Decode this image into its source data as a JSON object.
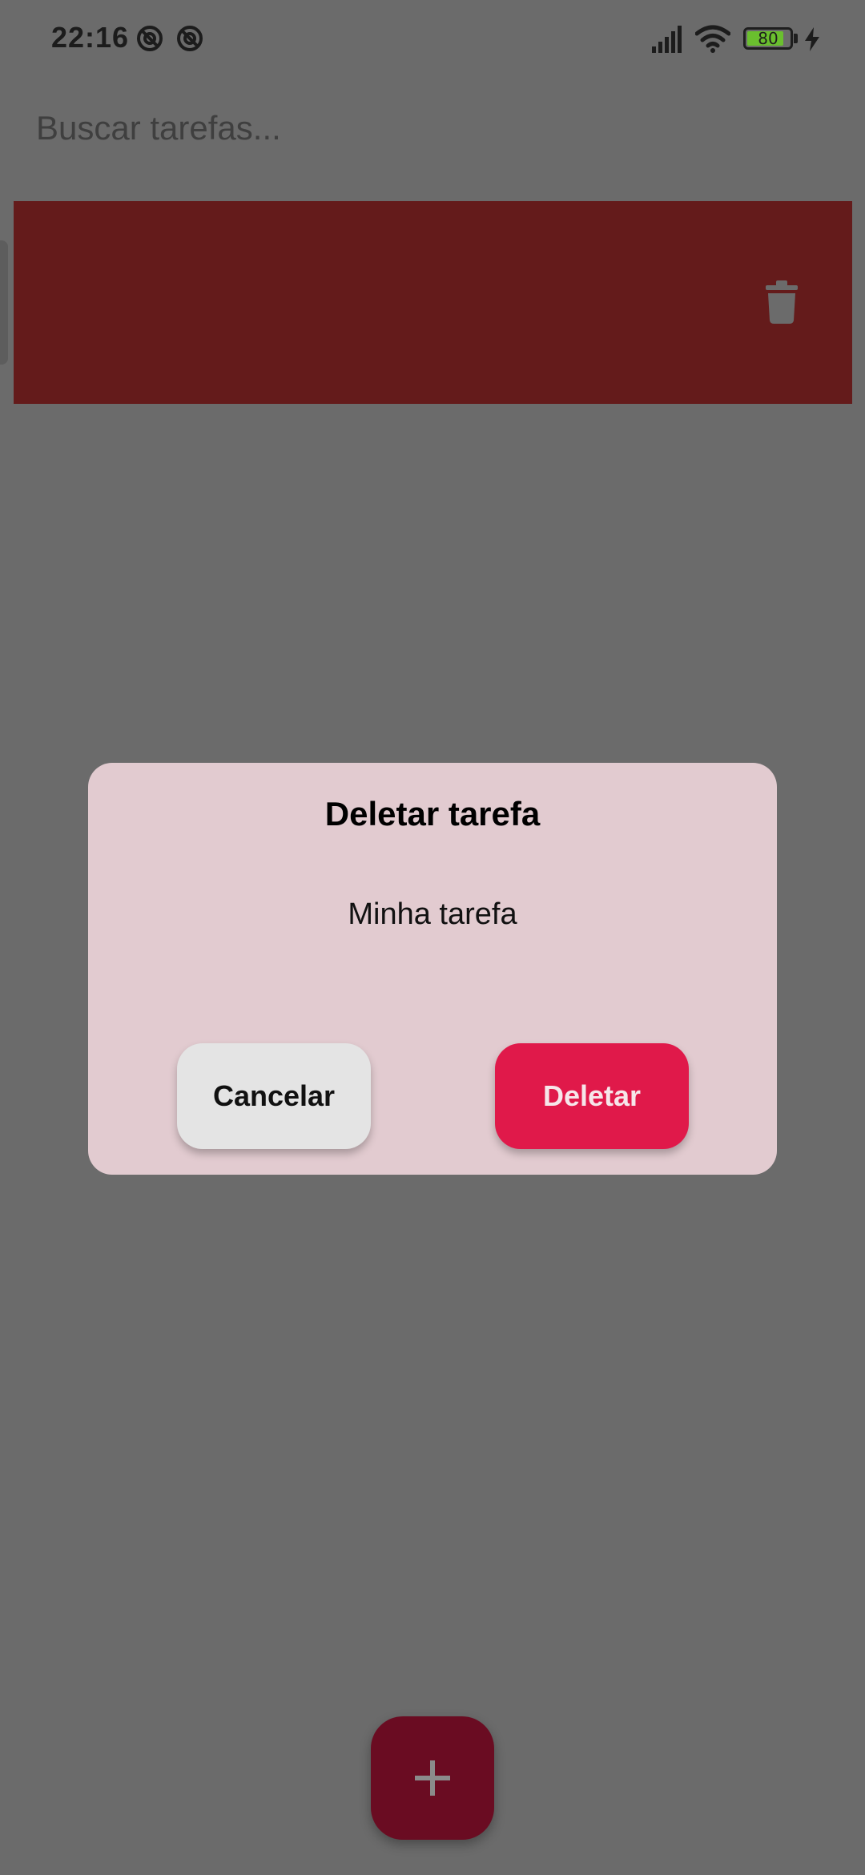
{
  "status_bar": {
    "time": "22:16",
    "battery_level": "80",
    "icons": [
      "notification-icon",
      "notification-icon",
      "signal-icon",
      "wifi-icon",
      "battery-icon",
      "charging-icon"
    ]
  },
  "search": {
    "placeholder": "Buscar tarefas..."
  },
  "task_row": {
    "action_icon": "trash-icon",
    "background_color": "#641b1b"
  },
  "dialog": {
    "title": "Deletar tarefa",
    "message": "Minha tarefa",
    "cancel_label": "Cancelar",
    "delete_label": "Deletar",
    "delete_color": "#e0194a"
  },
  "fab": {
    "icon": "plus-icon",
    "color": "#6a0c22"
  }
}
